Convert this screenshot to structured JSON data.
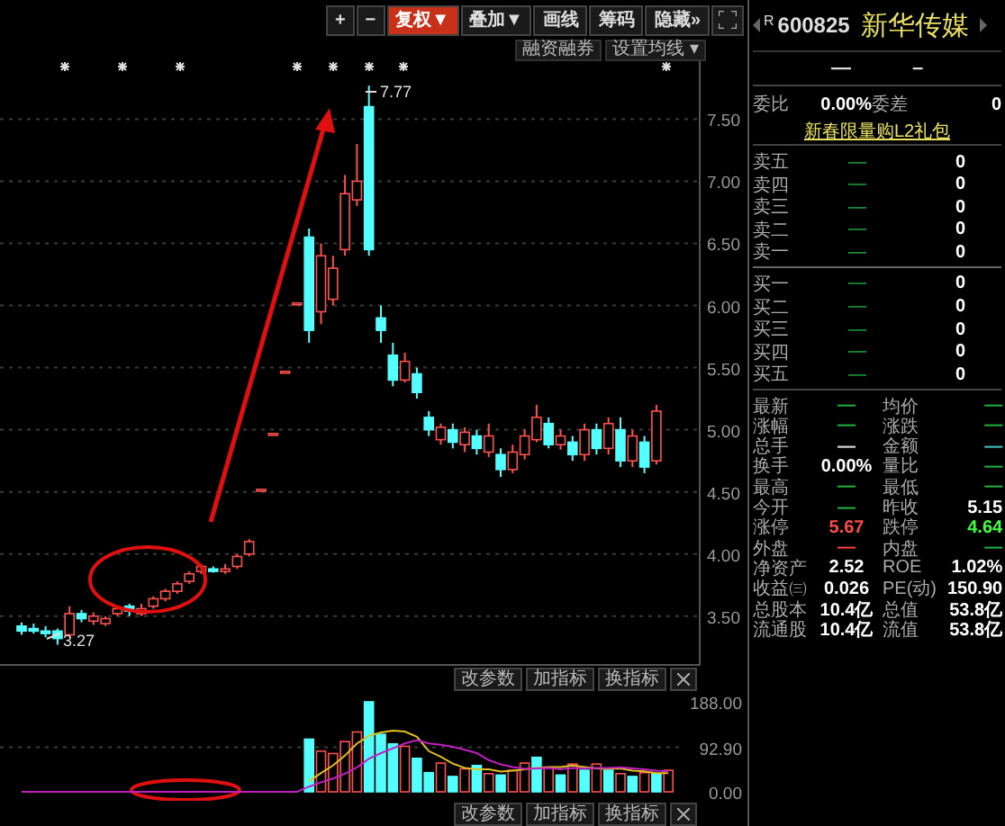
{
  "toolbar": [
    {
      "label": "+",
      "selected": false
    },
    {
      "label": "−",
      "selected": false
    },
    {
      "label": "复权▼",
      "selected": true
    },
    {
      "label": "叠加▼",
      "selected": false
    },
    {
      "label": "画线",
      "selected": false
    },
    {
      "label": "筹码",
      "selected": false
    },
    {
      "label": "隐藏»",
      "selected": false
    }
  ],
  "chart_buttons": [
    "融资融券",
    "设置均线 ▾"
  ],
  "price_marks": {
    "high": "7.77",
    "low": "3.27"
  },
  "price_chart": {
    "chart_data": {
      "type": "candlestick",
      "ylim": [
        3.1,
        8.14
      ],
      "yticks": [
        {
          "value": 7.5,
          "label": "7.50"
        },
        {
          "value": 7,
          "label": "7.00"
        },
        {
          "value": 6.5,
          "label": "6.50"
        },
        {
          "value": 6,
          "label": "6.00"
        },
        {
          "value": 5.5,
          "label": "5.50"
        },
        {
          "value": 5,
          "label": "5.00"
        },
        {
          "value": 4.5,
          "label": "4.50"
        },
        {
          "value": 4,
          "label": "4.00"
        },
        {
          "value": 3.5,
          "label": "3.50"
        }
      ],
      "grid": true,
      "ohlc": [
        [
          3.42,
          3.45,
          3.35,
          3.38
        ],
        [
          3.4,
          3.44,
          3.36,
          3.38
        ],
        [
          3.38,
          3.42,
          3.33,
          3.36
        ],
        [
          3.38,
          3.4,
          3.27,
          3.32
        ],
        [
          3.35,
          3.58,
          3.33,
          3.52
        ],
        [
          3.52,
          3.55,
          3.45,
          3.48
        ],
        [
          3.46,
          3.53,
          3.43,
          3.5
        ],
        [
          3.44,
          3.5,
          3.42,
          3.48
        ],
        [
          3.52,
          3.58,
          3.5,
          3.56
        ],
        [
          3.58,
          3.6,
          3.5,
          3.54
        ],
        [
          3.52,
          3.6,
          3.5,
          3.56
        ],
        [
          3.58,
          3.66,
          3.56,
          3.64
        ],
        [
          3.64,
          3.72,
          3.62,
          3.7
        ],
        [
          3.7,
          3.78,
          3.68,
          3.76
        ],
        [
          3.78,
          3.86,
          3.76,
          3.84
        ],
        [
          3.86,
          3.92,
          3.84,
          3.9
        ],
        [
          3.88,
          3.9,
          3.85,
          3.86
        ],
        [
          3.86,
          3.92,
          3.84,
          3.88
        ],
        [
          3.9,
          4.0,
          3.88,
          3.98
        ],
        [
          4.0,
          4.12,
          3.98,
          4.1
        ],
        [
          4.52,
          4.52,
          4.52,
          4.52
        ],
        [
          4.97,
          4.97,
          4.97,
          4.97
        ],
        [
          5.47,
          5.47,
          5.47,
          5.47
        ],
        [
          6.02,
          6.02,
          6.02,
          6.02
        ],
        [
          6.55,
          6.62,
          5.7,
          5.8
        ],
        [
          5.95,
          6.5,
          5.85,
          6.4
        ],
        [
          6.05,
          6.4,
          6.0,
          6.3
        ],
        [
          6.45,
          7.05,
          6.4,
          6.9
        ],
        [
          6.85,
          7.3,
          6.8,
          7.0
        ],
        [
          7.6,
          7.77,
          6.4,
          6.45
        ],
        [
          5.9,
          6.0,
          5.7,
          5.8
        ],
        [
          5.6,
          5.7,
          5.35,
          5.4
        ],
        [
          5.4,
          5.62,
          5.38,
          5.55
        ],
        [
          5.45,
          5.5,
          5.25,
          5.3
        ],
        [
          5.1,
          5.15,
          4.95,
          5.0
        ],
        [
          4.92,
          5.05,
          4.88,
          5.02
        ],
        [
          5.0,
          5.05,
          4.85,
          4.9
        ],
        [
          4.88,
          5.02,
          4.82,
          4.98
        ],
        [
          4.95,
          5.0,
          4.8,
          4.85
        ],
        [
          4.82,
          5.05,
          4.78,
          4.95
        ],
        [
          4.8,
          4.85,
          4.62,
          4.68
        ],
        [
          4.68,
          4.88,
          4.65,
          4.82
        ],
        [
          4.8,
          5.0,
          4.76,
          4.95
        ],
        [
          4.92,
          5.2,
          4.9,
          5.1
        ],
        [
          5.05,
          5.1,
          4.85,
          4.88
        ],
        [
          4.88,
          5.0,
          4.84,
          4.95
        ],
        [
          4.9,
          4.95,
          4.75,
          4.8
        ],
        [
          4.8,
          5.05,
          4.75,
          5.0
        ],
        [
          5.0,
          5.05,
          4.8,
          4.85
        ],
        [
          4.85,
          5.1,
          4.8,
          5.05
        ],
        [
          5.0,
          5.1,
          4.7,
          4.75
        ],
        [
          4.75,
          5.0,
          4.7,
          4.95
        ],
        [
          4.9,
          4.95,
          4.65,
          4.7
        ],
        [
          4.75,
          5.2,
          4.72,
          5.15
        ]
      ]
    }
  },
  "volume_toolbar": [
    "改参数",
    "加指标",
    "换指标"
  ],
  "volume_chart": {
    "chart_data": {
      "type": "bar",
      "ylim": [
        0,
        188
      ],
      "yticks": [
        {
          "value": 188,
          "label": "188.00"
        },
        {
          "value": 92.9,
          "label": "92.90"
        },
        {
          "value": 0,
          "label": "0.00"
        }
      ],
      "series": [
        {
          "color": "#ff5050",
          "values": [
            null,
            null,
            null,
            null,
            null,
            null,
            null,
            null,
            null,
            null,
            null,
            null,
            null,
            null,
            null,
            null,
            null,
            null,
            null,
            null,
            null,
            null,
            null,
            null,
            null,
            85,
            80,
            105,
            125,
            null,
            null,
            null,
            95,
            null,
            null,
            60,
            null,
            48,
            null,
            38,
            null,
            45,
            60,
            null,
            50,
            null,
            58,
            null,
            58,
            null,
            38,
            null,
            40,
            null,
            45
          ]
        },
        {
          "color": "#54ffff",
          "values": [
            null,
            null,
            null,
            null,
            null,
            null,
            null,
            null,
            null,
            null,
            null,
            null,
            null,
            null,
            null,
            null,
            null,
            null,
            null,
            null,
            null,
            null,
            null,
            null,
            110,
            null,
            null,
            null,
            null,
            188,
            120,
            100,
            null,
            70,
            40,
            null,
            32,
            null,
            55,
            null,
            35,
            null,
            null,
            72,
            null,
            35,
            null,
            45,
            null,
            45,
            null,
            32,
            null,
            38,
            null
          ]
        }
      ]
    }
  },
  "average_chart": {
    "chart_data": {
      "type": "line",
      "ylim": [
        0,
        188
      ],
      "series": [
        {
          "color": "#e0c020",
          "values": [
            null,
            null,
            null,
            null,
            null,
            null,
            null,
            null,
            null,
            null,
            null,
            null,
            null,
            null,
            null,
            null,
            null,
            null,
            null,
            null,
            null,
            null,
            null,
            null,
            22,
            39,
            55,
            76,
            101,
            117,
            124,
            128,
            126,
            115,
            85,
            73,
            59,
            50,
            47,
            47,
            42,
            44,
            47,
            50,
            52,
            52,
            55,
            52,
            49,
            48,
            49,
            44,
            43,
            39,
            39
          ]
        },
        {
          "color": "#c020c0",
          "values": [
            0,
            0,
            0,
            0,
            0,
            0,
            0,
            0,
            0,
            0,
            0,
            0,
            0,
            0,
            0,
            0,
            0,
            0,
            0,
            0,
            0,
            0,
            0,
            0,
            11,
            20,
            28,
            38,
            51,
            69,
            81,
            91,
            101,
            108,
            101,
            98,
            94,
            88,
            81,
            66,
            57,
            52,
            48,
            49,
            50,
            47,
            50,
            49,
            50,
            50,
            51,
            49,
            47,
            44,
            43
          ]
        }
      ]
    }
  },
  "bottom_toolbar": [
    "改参数",
    "加指标",
    "换指标"
  ],
  "quote": {
    "prefix": "R",
    "code": "600825",
    "name": "新华传媒",
    "price": "—",
    "change": "–",
    "ratio": [
      {
        "label": "委比",
        "value": "0.00%"
      },
      {
        "label": "委差",
        "value": "0"
      }
    ],
    "promo": "新春限量购L2礼包",
    "asks": [
      {
        "label": "卖五",
        "price": "—",
        "volume": "0"
      },
      {
        "label": "卖四",
        "price": "—",
        "volume": "0"
      },
      {
        "label": "卖三",
        "price": "—",
        "volume": "0"
      },
      {
        "label": "卖二",
        "price": "—",
        "volume": "0"
      },
      {
        "label": "卖一",
        "price": "—",
        "volume": "0"
      }
    ],
    "bids": [
      {
        "label": "买一",
        "price": "—",
        "volume": "0"
      },
      {
        "label": "买二",
        "price": "—",
        "volume": "0"
      },
      {
        "label": "买三",
        "price": "—",
        "volume": "0"
      },
      {
        "label": "买四",
        "price": "—",
        "volume": "0"
      },
      {
        "label": "买五",
        "price": "—",
        "volume": "0"
      }
    ],
    "stats": [
      {
        "label": "最新",
        "value": "—",
        "color": "#20b040"
      },
      {
        "label": "均价",
        "value": "—",
        "color": "#20b040"
      },
      {
        "label": "涨幅",
        "value": "—",
        "color": "#20b040"
      },
      {
        "label": "涨跌",
        "value": "—",
        "color": "#20b040"
      },
      {
        "label": "总手",
        "value": "—",
        "color": "#e0e0e0"
      },
      {
        "label": "金额",
        "value": "—",
        "color": "#40c0c0"
      },
      {
        "label": "换手",
        "value": "0.00%",
        "color": "#ffffff"
      },
      {
        "label": "量比",
        "value": "—",
        "color": "#20b040"
      },
      {
        "label": "最高",
        "value": "—",
        "color": "#20b040"
      },
      {
        "label": "最低",
        "value": "—",
        "color": "#20b040"
      },
      {
        "label": "今开",
        "value": "—",
        "color": "#20b040"
      },
      {
        "label": "昨收",
        "value": "5.15",
        "color": "#ffffff"
      },
      {
        "label": "涨停",
        "value": "5.67",
        "color": "#ff4a4a"
      },
      {
        "label": "跌停",
        "value": "4.64",
        "color": "#40ff40"
      },
      {
        "label": "外盘",
        "value": "—",
        "color": "#ff4040"
      },
      {
        "label": "内盘",
        "value": "—",
        "color": "#20b040"
      },
      {
        "label": "净资产",
        "value": "2.52",
        "color": "#ffffff"
      },
      {
        "label": "ROE",
        "value": "1.02%",
        "color": "#ffffff"
      },
      {
        "label": "收益㈢",
        "value": "0.026",
        "color": "#ffffff"
      },
      {
        "label": "PE(动)",
        "value": "150.90",
        "color": "#ffffff"
      },
      {
        "label": "总股本",
        "value": "10.4亿",
        "color": "#ffffff"
      },
      {
        "label": "总值",
        "value": "53.8亿",
        "color": "#ffffff"
      },
      {
        "label": "流通股",
        "value": "10.4亿",
        "color": "#ffffff"
      },
      {
        "label": "流值",
        "value": "53.8亿",
        "color": "#ffffff"
      }
    ]
  }
}
